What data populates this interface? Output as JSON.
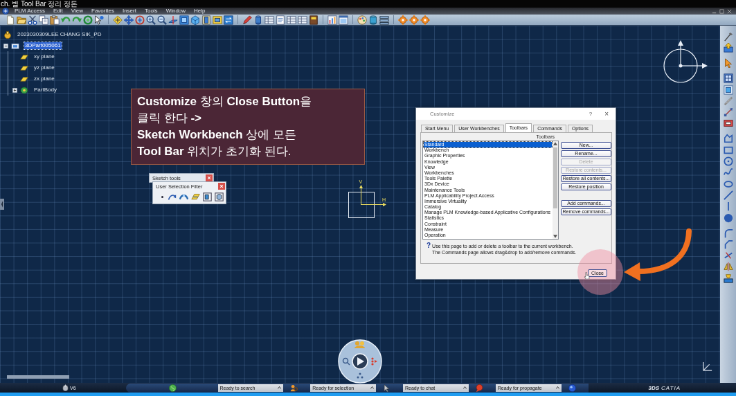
{
  "window": {
    "title": "ch. 별 Tool Bar 정리 정돈"
  },
  "menu_bar": {
    "items": [
      "PLM Access",
      "Edit",
      "View",
      "Favorites",
      "Insert",
      "Tools",
      "Window",
      "Help"
    ]
  },
  "tree": {
    "items": [
      {
        "label": "2023030309LEE CHANG SIK_PD",
        "kind": "product",
        "selected": false,
        "children": [
          {
            "label": "3DPart005061",
            "kind": "part",
            "selected": true,
            "expanded": true,
            "children": [
              {
                "label": "xy plane",
                "kind": "plane",
                "selected": false
              },
              {
                "label": "yz plane",
                "kind": "plane",
                "selected": false
              },
              {
                "label": "zx plane",
                "kind": "plane",
                "selected": false
              },
              {
                "label": "PartBody",
                "kind": "body",
                "selected": false,
                "expanded": false
              }
            ]
          }
        ]
      }
    ]
  },
  "callout": {
    "lines": [
      "**Customize** 창의 **Close Button**을",
      "클릭 한다 **->**",
      "**Sketch Workbench** 상에 모든",
      "**Tool Bar** 위치가 초기화 된다."
    ]
  },
  "floating_toolbars": [
    {
      "title": "Sketch tools"
    },
    {
      "title": "User Selection Filter"
    }
  ],
  "sketch_axes": {
    "v_label": "V",
    "h_label": "H"
  },
  "customize_dialog": {
    "title": "Customize",
    "help": "?",
    "close_glyph": "×",
    "tabs": [
      {
        "label": "Start Menu",
        "selected": false
      },
      {
        "label": "User Workbenches",
        "selected": false
      },
      {
        "label": "Toolbars",
        "selected": true
      },
      {
        "label": "Commands",
        "selected": false
      },
      {
        "label": "Options",
        "selected": false
      }
    ],
    "list_label": "Toolbars",
    "toolbars": [
      {
        "label": "Standard",
        "selected": true
      },
      {
        "label": "Workbench",
        "selected": false
      },
      {
        "label": "Graphic Properties",
        "selected": false
      },
      {
        "label": "Knowledge",
        "selected": false
      },
      {
        "label": "View",
        "selected": false
      },
      {
        "label": "Workbenches",
        "selected": false
      },
      {
        "label": "Tools Palette",
        "selected": false
      },
      {
        "label": "3Dx Device",
        "selected": false
      },
      {
        "label": "Maintenance Tools",
        "selected": false
      },
      {
        "label": "PLM Applicability Project Access",
        "selected": false
      },
      {
        "label": "Immersive Virtuality",
        "selected": false
      },
      {
        "label": "Catalog",
        "selected": false
      },
      {
        "label": "Manage PLM Knowledge-based Applicative Configurations",
        "selected": false
      },
      {
        "label": "Statistics",
        "selected": false
      },
      {
        "label": "Constraint",
        "selected": false
      },
      {
        "label": "Measure",
        "selected": false
      },
      {
        "label": "Operation",
        "selected": false
      }
    ],
    "buttons": [
      {
        "label": "New...",
        "disabled": false
      },
      {
        "label": "Rename...",
        "disabled": false
      },
      {
        "label": "Delete",
        "disabled": true
      },
      {
        "label": "Restore contents...",
        "disabled": true
      },
      {
        "label": "Restore all contents...",
        "disabled": false
      },
      {
        "label": "Restore position",
        "disabled": false
      }
    ],
    "command_buttons": [
      {
        "label": "Add commands...",
        "disabled": false
      },
      {
        "label": "Remove commands...",
        "disabled": false
      }
    ],
    "info_glyph": "?",
    "info_lines": [
      "Use this page to add or delete a toolbar to the current workbench.",
      "The Commands page allows drag&drop to add/remove commands."
    ],
    "close_button": "Close"
  },
  "taskbar": {
    "app_label": "V6",
    "status_panes": [
      {
        "text": "Ready to search"
      },
      {
        "text": "Ready for selection"
      },
      {
        "text": "Ready to chat"
      },
      {
        "text": "Ready for propagate"
      }
    ],
    "brand": {
      "mark": "3DS",
      "name": "CATIA"
    }
  }
}
